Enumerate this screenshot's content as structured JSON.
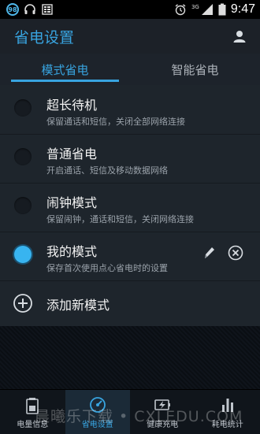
{
  "status_bar": {
    "badge": "98",
    "signal_label": "3G",
    "time": "9:47",
    "icons": [
      "headset-icon",
      "notes-icon",
      "alarm-icon",
      "signal-icon",
      "battery-icon"
    ]
  },
  "app_bar": {
    "title": "省电设置",
    "user_icon": "user-icon"
  },
  "tabs": [
    {
      "label": "模式省电",
      "active": true
    },
    {
      "label": "智能省电",
      "active": false
    }
  ],
  "modes": [
    {
      "title": "超长待机",
      "desc": "保留通话和短信，关闭全部网络连接",
      "selected": false
    },
    {
      "title": "普通省电",
      "desc": "开启通话、短信及移动数据网络",
      "selected": false
    },
    {
      "title": "闹钟模式",
      "desc": "保留闹钟，通话和短信，关闭网络连接",
      "selected": false
    },
    {
      "title": "我的模式",
      "desc": "保存首次使用点心省电时的设置",
      "selected": true
    }
  ],
  "add_mode": {
    "label": "添加新模式"
  },
  "bottom_nav": [
    {
      "label": "电量信息",
      "icon": "battery-info-icon",
      "active": false
    },
    {
      "label": "省电设置",
      "icon": "gauge-icon",
      "active": true
    },
    {
      "label": "健康充电",
      "icon": "charging-icon",
      "active": false
    },
    {
      "label": "耗电统计",
      "icon": "bar-chart-icon",
      "active": false
    }
  ],
  "watermark": "晨曦乐下载 • CXLEDU.COM",
  "colors": {
    "accent": "#38a4e0",
    "background": "#1e252c"
  }
}
